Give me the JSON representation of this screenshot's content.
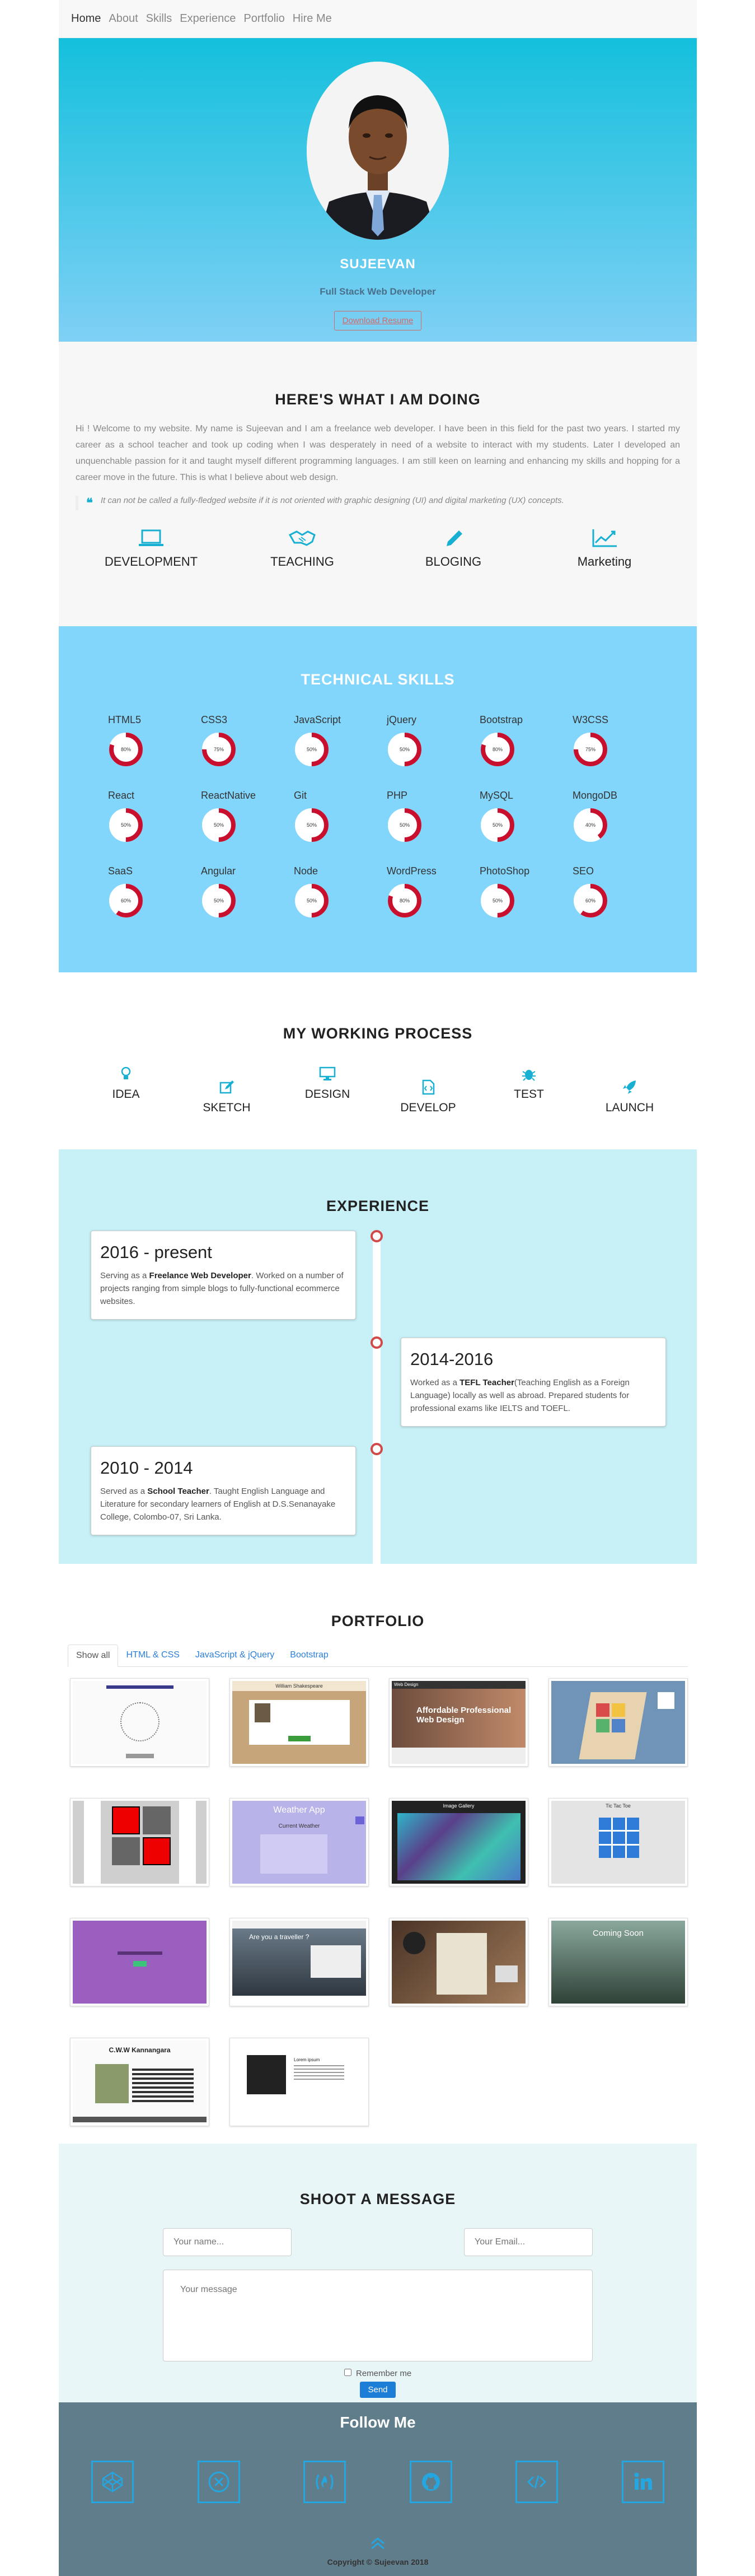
{
  "nav": {
    "items": [
      {
        "label": "Home",
        "active": true
      },
      {
        "label": "About"
      },
      {
        "label": "Skills"
      },
      {
        "label": "Experience"
      },
      {
        "label": "Portfolio"
      },
      {
        "label": "Hire Me"
      }
    ]
  },
  "hero": {
    "name": "SUJEEVAN",
    "role": "Full Stack Web Developer",
    "button": "Download Resume"
  },
  "about": {
    "title": "HERE'S WHAT I AM DOING",
    "intro": "Hi ! Welcome to my website. My name is Sujeevan and I am a freelance web developer. I have been in this field for the past two years. I started my career as a school teacher and took up coding when I was desperately in need of a website to interact with my students. Later I developed an unquenchable passion for it and taught myself different programming languages. I am still keen on learning and enhancing my skills and hopping for a career move in the future. This is what I believe about web design.",
    "quote": "It can not be called a fully-fledged website if it is not oriented with graphic designing (UI) and digital marketing (UX) concepts.",
    "doing": [
      {
        "label": "DEVELOPMENT",
        "icon": "laptop-icon"
      },
      {
        "label": "TEACHING",
        "icon": "handshake-icon"
      },
      {
        "label": "BLOGING",
        "icon": "pencil-icon"
      },
      {
        "label": "Marketing",
        "icon": "chart-line-icon"
      }
    ]
  },
  "skills": {
    "title": "TECHNICAL SKILLS",
    "items": [
      {
        "name": "HTML5",
        "pct": "80%",
        "value": 80
      },
      {
        "name": "CSS3",
        "pct": "75%",
        "value": 75
      },
      {
        "name": "JavaScript",
        "pct": "50%",
        "value": 50
      },
      {
        "name": "jQuery",
        "pct": "50%",
        "value": 50
      },
      {
        "name": "Bootstrap",
        "pct": "80%",
        "value": 80
      },
      {
        "name": "W3CSS",
        "pct": "75%",
        "value": 75
      },
      {
        "name": "React",
        "pct": "50%",
        "value": 50
      },
      {
        "name": "ReactNative",
        "pct": "50%",
        "value": 50
      },
      {
        "name": "Git",
        "pct": "50%",
        "value": 50
      },
      {
        "name": "PHP",
        "pct": "50%",
        "value": 50
      },
      {
        "name": "MySQL",
        "pct": "50%",
        "value": 50
      },
      {
        "name": "MongoDB",
        "pct": "40%",
        "value": 40
      },
      {
        "name": "SaaS",
        "pct": "60%",
        "value": 60
      },
      {
        "name": "Angular",
        "pct": "50%",
        "value": 50
      },
      {
        "name": "Node",
        "pct": "50%",
        "value": 50
      },
      {
        "name": "WordPress",
        "pct": "80%",
        "value": 80
      },
      {
        "name": "PhotoShop",
        "pct": "50%",
        "value": 50
      },
      {
        "name": "SEO",
        "pct": "60%",
        "value": 60
      }
    ],
    "ring_color": "#c8102e"
  },
  "process": {
    "title": "MY WORKING PROCESS",
    "steps": [
      {
        "label": "IDEA",
        "icon": "lightbulb-icon"
      },
      {
        "label": "SKETCH",
        "icon": "edit-icon"
      },
      {
        "label": "DESIGN",
        "icon": "desktop-icon"
      },
      {
        "label": "DEVELOP",
        "icon": "file-code-icon"
      },
      {
        "label": "TEST",
        "icon": "bug-icon"
      },
      {
        "label": "LAUNCH",
        "icon": "rocket-icon"
      }
    ]
  },
  "experience": {
    "title": "EXPERIENCE",
    "entries": [
      {
        "period": "2016 - present",
        "pre": "Serving as a ",
        "role": "Freelance Web Developer",
        "post": ". Worked on a number of projects ranging from simple blogs to fully-functional ecommerce websites."
      },
      {
        "period": "2014-2016",
        "pre": "Worked as a ",
        "role": "TEFL Teacher",
        "post": "(Teaching English as a Foreign Language) locally as well as abroad. Prepared students for professional exams like IELTS and TOEFL."
      },
      {
        "period": "2010 - 2014",
        "pre": "Served as a ",
        "role": "School Teacher",
        "post": ". Taught English Language and Literature for secondary learners of English at D.S.Senanayake College, Colombo-07, Sri Lanka."
      }
    ]
  },
  "portfolio": {
    "title": "PORTFOLIO",
    "tabs": [
      "Show all",
      "HTML & CSS",
      "JavaScript & jQuery",
      "Bootstrap"
    ],
    "thumbs": {
      "t2": "William Shakespeare",
      "t3_brand": "Web Design",
      "t3_headline": "Affordable Professional Web Design",
      "t6": "Weather App",
      "t6_sub": "Current Weather",
      "t7": "Image Gallery",
      "t8": "Tic Tac Toe",
      "t10": "Are you a traveller ?",
      "t12": "Coming Soon",
      "t13": "C.W.W Kannangara",
      "t14": "Lorem ipsum"
    }
  },
  "contact": {
    "title": "SHOOT A MESSAGE",
    "name_placeholder": "Your name...",
    "email_placeholder": "Your Email...",
    "message_placeholder": "Your message",
    "remember": "Remember me",
    "send": "Send"
  },
  "footer": {
    "title": "Follow Me",
    "social": [
      "codepen-icon",
      "codesandbox-icon",
      "freecodecamp-icon",
      "github-icon",
      "code-icon",
      "linkedin-icon"
    ],
    "copyright": "Copyright © Sujeevan 2018",
    "accent": "#24a6e0"
  }
}
